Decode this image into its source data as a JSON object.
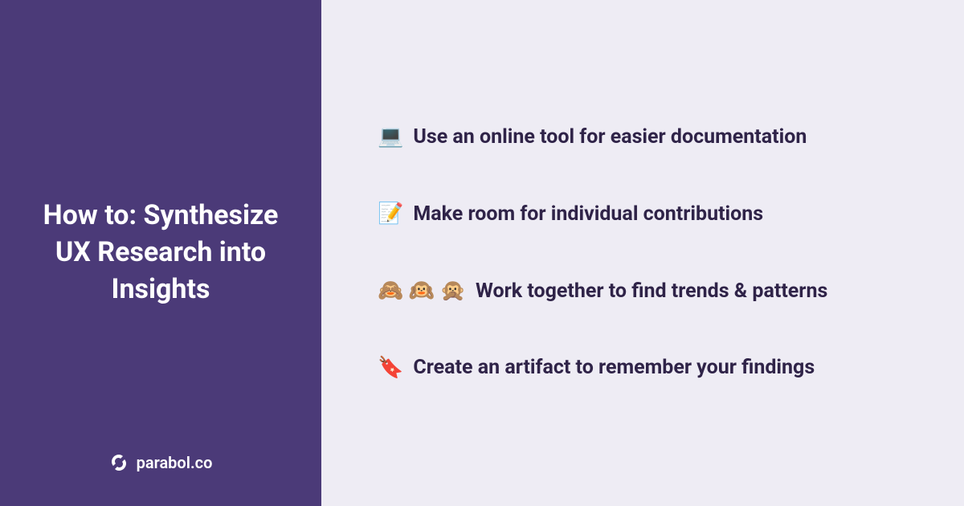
{
  "sidebar": {
    "title": "How to: Synthesize UX Research into Insights",
    "brand": "parabol.co"
  },
  "items": [
    {
      "emoji": "💻",
      "text": "Use an online tool for easier documentation"
    },
    {
      "emoji": "📝",
      "text": "Make room for individual contributions"
    },
    {
      "emoji": "🙈 🙉 🙊",
      "text": "Work together to find trends & patterns"
    },
    {
      "emoji": "🔖",
      "text": "Create an artifact to remember your findings"
    }
  ],
  "colors": {
    "sidebar_bg": "#4B3A78",
    "main_bg": "#EEECF4",
    "text_dark": "#2F2348",
    "text_light": "#FFFFFF"
  }
}
